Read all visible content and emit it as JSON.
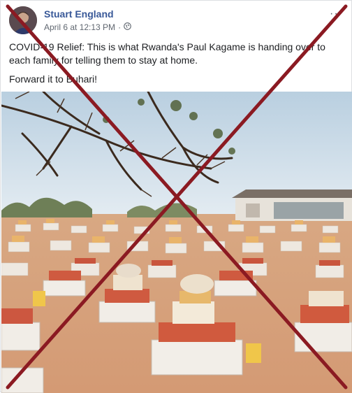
{
  "post": {
    "author": "Stuart England",
    "timestamp": "April 6 at 12:13 PM",
    "separator": "·",
    "privacy_icon": "globe-icon",
    "more_label": "···",
    "text_line1": "COVID-19 Relief: This is what Rwanda's Paul Kagame is handing over to each family for telling them to stay at home.",
    "text_line2": "Forward it to Buhari!"
  },
  "overlay": {
    "icon": "x-mark",
    "color": "#8b1a22"
  }
}
